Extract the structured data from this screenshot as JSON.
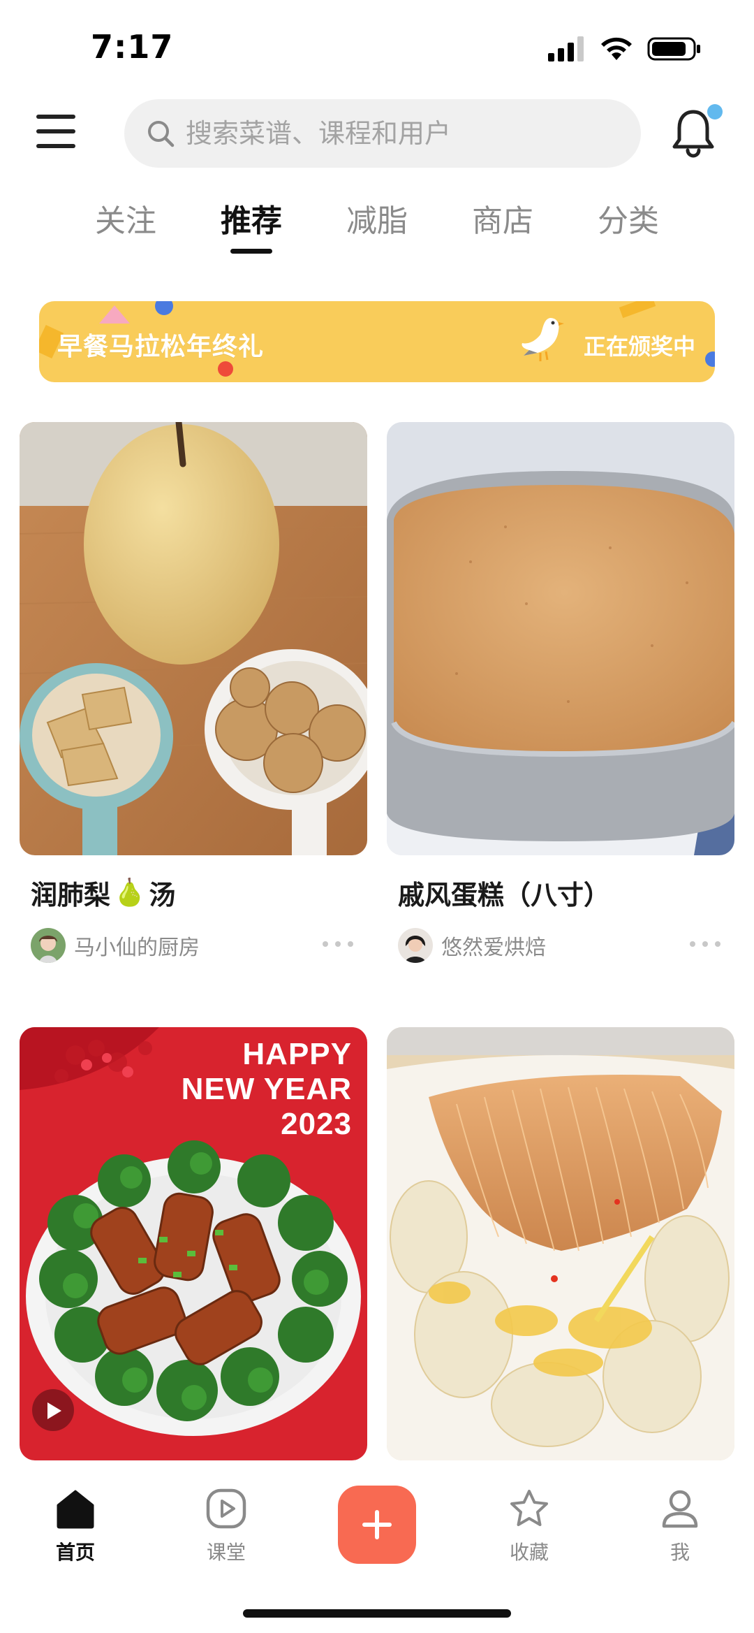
{
  "status_bar": {
    "time": "7:17"
  },
  "search": {
    "placeholder": "搜索菜谱、课程和用户"
  },
  "tabs": [
    {
      "label": "关注"
    },
    {
      "label": "推荐",
      "active": true
    },
    {
      "label": "减脂"
    },
    {
      "label": "商店"
    },
    {
      "label": "分类"
    }
  ],
  "banner": {
    "title": "早餐马拉松年终礼",
    "status": "正在颁奖中"
  },
  "feed": [
    {
      "title_prefix": "润肺梨",
      "title_emoji": "🍐",
      "title_suffix": "汤",
      "author": "马小仙的厨房"
    },
    {
      "title": "戚风蛋糕（八寸）",
      "author": "悠然爱烘焙"
    },
    {
      "image_text": [
        "HAPPY",
        "NEW YEAR",
        "2023"
      ],
      "has_video": true
    },
    {}
  ],
  "bottom_nav": {
    "items": [
      {
        "label": "首页",
        "icon": "home-icon",
        "active": true
      },
      {
        "label": "课堂",
        "icon": "play-icon"
      },
      {
        "label": "收藏",
        "icon": "star-icon"
      },
      {
        "label": "我",
        "icon": "user-icon"
      }
    ],
    "add_icon": "plus-icon"
  },
  "colors": {
    "accent": "#f86a52",
    "banner": "#f9cc5a",
    "notification_dot": "#62b9ee"
  }
}
